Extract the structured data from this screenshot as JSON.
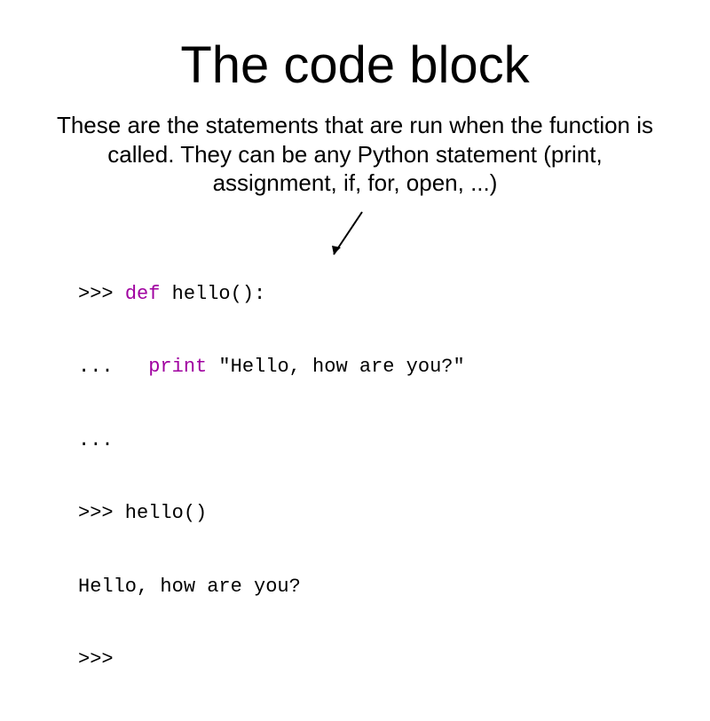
{
  "title": "The code block",
  "body": "These are the statements that are run when the function is called.  They can be any Python statement (print, assignment, if, for, open, ...)",
  "code": {
    "line1_prompt": ">>> ",
    "line1_kw": "def",
    "line1_rest": " hello():",
    "line2_cont": "...   ",
    "line2_kw": "print",
    "line2_rest": " \"Hello, how are you?\"",
    "line3": "...",
    "line4": ">>> hello()",
    "line5": "Hello, how are you?",
    "line6": ">>>"
  }
}
